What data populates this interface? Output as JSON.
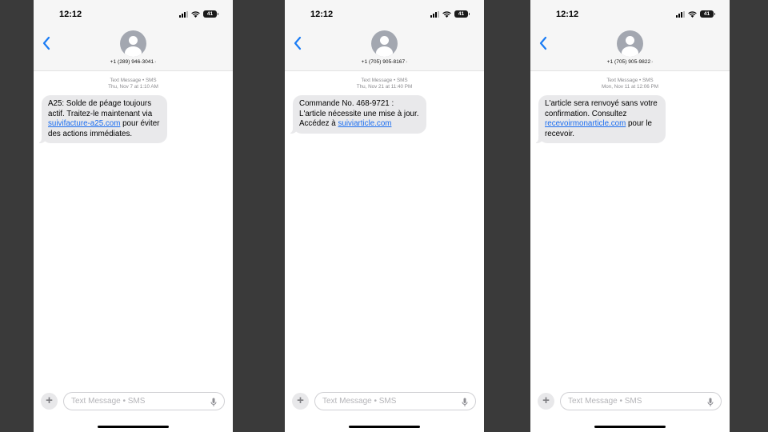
{
  "status_bar": {
    "time": "12:12",
    "battery": "41"
  },
  "conversations": [
    {
      "contact_number": "+1 (289) 946-3041",
      "meta_type": "Text Message • SMS",
      "meta_date": "Thu, Nov 7 at 1:10 AM",
      "message_lines": [
        {
          "text": "A25: Solde de péage toujours",
          "link": "",
          "after": ""
        },
        {
          "text": "actif. Traitez-le maintenant via",
          "link": "",
          "after": ""
        },
        {
          "text": "",
          "link": "suivifacture-a25.com",
          "after": " pour éviter"
        },
        {
          "text": "des actions immédiates.",
          "link": "",
          "after": ""
        }
      ]
    },
    {
      "contact_number": "+1 (705) 905-8167",
      "meta_type": "Text Message • SMS",
      "meta_date": "Thu, Nov 21 at 11:40 PM",
      "message_lines": [
        {
          "text": " Commande No. 468-9721 :",
          "link": "",
          "after": ""
        },
        {
          "text": "L'article nécessite une mise à jour.",
          "link": "",
          "after": ""
        },
        {
          "text": "Accédez à ",
          "link": "suiviarticle.com",
          "after": ""
        }
      ]
    },
    {
      "contact_number": "+1 (705) 905-9822",
      "meta_type": "Text Message • SMS",
      "meta_date": "Mon, Nov 11 at 12:06 PM",
      "message_lines": [
        {
          "text": " L'article sera renvoyé sans votre",
          "link": "",
          "after": ""
        },
        {
          "text": "confirmation. Consultez",
          "link": "",
          "after": ""
        },
        {
          "text": "",
          "link": "recevoirmonarticle.com",
          "after": " pour le"
        },
        {
          "text": "recevoir.",
          "link": "",
          "after": ""
        }
      ]
    }
  ],
  "composer": {
    "placeholder": "Text Message • SMS"
  },
  "colors": {
    "link": "#1a6df0",
    "back_chevron": "#1a7cf5",
    "incoming_bubble": "#e9e9eb",
    "background": "#3a3a3a"
  },
  "icons": [
    "back-chevron-icon",
    "avatar-icon",
    "signal-icon",
    "wifi-icon",
    "battery-icon",
    "plus-icon",
    "microphone-icon"
  ]
}
